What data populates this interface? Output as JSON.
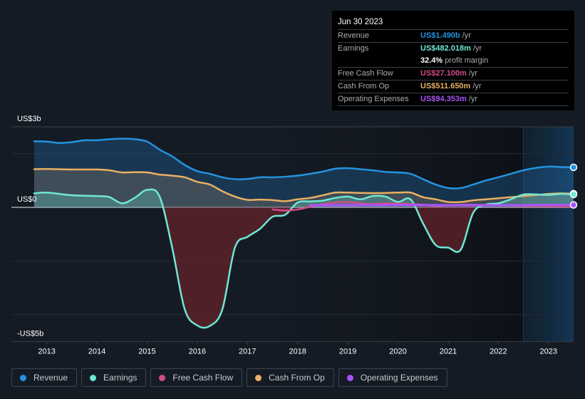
{
  "tooltip": {
    "date": "Jun 30 2023",
    "rows": [
      {
        "label": "Revenue",
        "value": "US$1.490b",
        "unit": "/yr",
        "color": "#2394df"
      },
      {
        "label": "Earnings",
        "value": "US$482.018m",
        "unit": "/yr",
        "color": "#6ee7d4"
      },
      {
        "label": "",
        "value": "32.4%",
        "unit": "profit margin",
        "color": "#ffffff"
      },
      {
        "label": "Free Cash Flow",
        "value": "US$27.100m",
        "unit": "/yr",
        "color": "#d04c8a"
      },
      {
        "label": "Cash From Op",
        "value": "US$511.650m",
        "unit": "/yr",
        "color": "#e9b063"
      },
      {
        "label": "Operating Expenses",
        "value": "US$94.353m",
        "unit": "/yr",
        "color": "#a855f7"
      }
    ]
  },
  "legend": [
    {
      "label": "Revenue",
      "color": "#2394df"
    },
    {
      "label": "Earnings",
      "color": "#6ee7d4"
    },
    {
      "label": "Free Cash Flow",
      "color": "#d04c8a"
    },
    {
      "label": "Cash From Op",
      "color": "#e9b063"
    },
    {
      "label": "Operating Expenses",
      "color": "#a855f7"
    }
  ],
  "chart_data": {
    "type": "area",
    "title": "",
    "xlabel": "",
    "ylabel": "",
    "y_tick_labels": [
      "US$3b",
      "US$0",
      "-US$5b"
    ],
    "y_ticks": [
      3,
      0,
      -5
    ],
    "ylim": [
      -5,
      3
    ],
    "xlim": [
      2012.75,
      2023.5
    ],
    "x_tick_labels": [
      "2013",
      "2014",
      "2015",
      "2016",
      "2017",
      "2018",
      "2019",
      "2020",
      "2021",
      "2022",
      "2023"
    ],
    "x_ticks": [
      2013,
      2014,
      2015,
      2016,
      2017,
      2018,
      2019,
      2020,
      2021,
      2022,
      2023
    ],
    "grid": true,
    "forecast_region_start": 2022.5,
    "series": [
      {
        "name": "Revenue",
        "color": "#2394df",
        "x": [
          2012.75,
          2013,
          2013.25,
          2013.5,
          2013.75,
          2014,
          2014.25,
          2014.5,
          2014.75,
          2015,
          2015.25,
          2015.5,
          2015.75,
          2016,
          2016.25,
          2016.5,
          2016.75,
          2017,
          2017.25,
          2017.5,
          2017.75,
          2018,
          2018.25,
          2018.5,
          2018.75,
          2019,
          2019.25,
          2019.5,
          2019.75,
          2020,
          2020.25,
          2020.5,
          2020.75,
          2021,
          2021.25,
          2021.5,
          2021.75,
          2022,
          2022.25,
          2022.5,
          2022.75,
          2023,
          2023.25,
          2023.5
        ],
        "values": [
          2.46,
          2.45,
          2.4,
          2.43,
          2.5,
          2.5,
          2.54,
          2.56,
          2.54,
          2.45,
          2.15,
          1.9,
          1.58,
          1.35,
          1.25,
          1.12,
          1.05,
          1.06,
          1.12,
          1.12,
          1.14,
          1.18,
          1.25,
          1.33,
          1.44,
          1.46,
          1.42,
          1.38,
          1.32,
          1.3,
          1.25,
          1.05,
          0.85,
          0.72,
          0.72,
          0.85,
          1.0,
          1.12,
          1.25,
          1.38,
          1.47,
          1.52,
          1.5,
          1.49
        ]
      },
      {
        "name": "Cash From Op",
        "color": "#e9b063",
        "x": [
          2012.75,
          2013,
          2013.5,
          2014,
          2014.25,
          2014.5,
          2014.75,
          2015,
          2015.25,
          2015.5,
          2015.75,
          2016,
          2016.25,
          2016.5,
          2016.75,
          2017,
          2017.25,
          2017.5,
          2017.75,
          2018,
          2018.25,
          2018.5,
          2018.75,
          2019,
          2019.5,
          2020,
          2020.25,
          2020.5,
          2020.75,
          2021,
          2021.25,
          2021.5,
          2021.75,
          2022,
          2022.25,
          2022.5,
          2022.75,
          2023,
          2023.25,
          2023.5
        ],
        "values": [
          1.42,
          1.43,
          1.41,
          1.41,
          1.38,
          1.3,
          1.31,
          1.3,
          1.22,
          1.18,
          1.12,
          0.95,
          0.85,
          0.6,
          0.4,
          0.28,
          0.29,
          0.27,
          0.23,
          0.3,
          0.35,
          0.45,
          0.55,
          0.55,
          0.53,
          0.55,
          0.55,
          0.38,
          0.3,
          0.2,
          0.2,
          0.26,
          0.3,
          0.34,
          0.38,
          0.42,
          0.46,
          0.5,
          0.52,
          0.51
        ]
      },
      {
        "name": "Earnings",
        "color": "#6ee7d4",
        "x": [
          2012.75,
          2013,
          2013.5,
          2014,
          2014.25,
          2014.5,
          2014.75,
          2015,
          2015.25,
          2015.5,
          2015.75,
          2016,
          2016.25,
          2016.5,
          2016.75,
          2017,
          2017.25,
          2017.5,
          2017.75,
          2018,
          2018.25,
          2018.5,
          2018.75,
          2019,
          2019.25,
          2019.5,
          2019.75,
          2020,
          2020.25,
          2020.5,
          2020.75,
          2021,
          2021.25,
          2021.5,
          2021.75,
          2022,
          2022.25,
          2022.5,
          2022.75,
          2023,
          2023.25,
          2023.5
        ],
        "values": [
          0.52,
          0.55,
          0.45,
          0.42,
          0.38,
          0.15,
          0.35,
          0.65,
          0.4,
          -1.5,
          -3.8,
          -4.4,
          -4.42,
          -3.8,
          -1.5,
          -1.1,
          -0.8,
          -0.35,
          -0.28,
          0.18,
          0.22,
          0.25,
          0.35,
          0.4,
          0.3,
          0.42,
          0.4,
          0.2,
          0.3,
          -0.6,
          -1.4,
          -1.5,
          -1.58,
          -0.2,
          0.1,
          0.15,
          0.3,
          0.48,
          0.48,
          0.46,
          0.5,
          0.48
        ]
      },
      {
        "name": "Free Cash Flow",
        "color": "#d04c8a",
        "x": [
          2017.5,
          2017.75,
          2018,
          2018.25,
          2018.5,
          2018.75,
          2019,
          2019.25,
          2019.5,
          2019.75,
          2020,
          2020.25,
          2020.5,
          2020.75,
          2021,
          2021.5,
          2022,
          2022.5,
          2023,
          2023.5
        ],
        "values": [
          -0.08,
          -0.12,
          -0.08,
          0.02,
          0.12,
          0.18,
          0.2,
          0.15,
          0.12,
          0.15,
          0.14,
          0.12,
          0.1,
          0.05,
          0.08,
          0.1,
          0.08,
          0.05,
          0.04,
          0.03
        ]
      },
      {
        "name": "Operating Expenses",
        "color": "#a855f7",
        "x": [
          2018.25,
          2019,
          2020,
          2021,
          2022,
          2023,
          2023.5
        ],
        "values": [
          0.08,
          0.08,
          0.09,
          0.08,
          0.08,
          0.09,
          0.09
        ]
      }
    ]
  }
}
